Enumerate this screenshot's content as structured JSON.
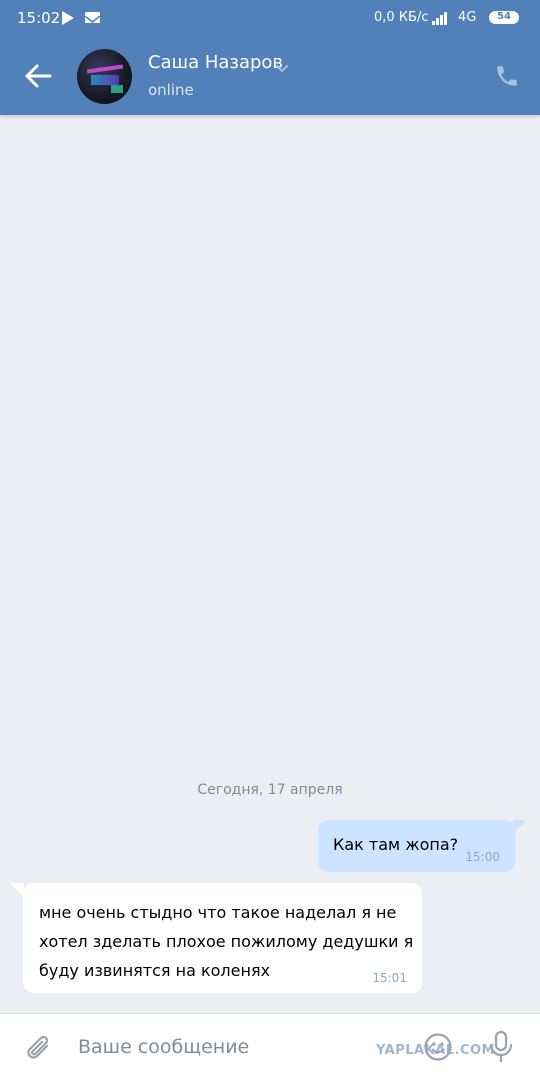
{
  "status_bar": {
    "time": "15:02",
    "speed": "0,0 КБ/с",
    "network": "4G",
    "battery": "54"
  },
  "header": {
    "contact_name": "Саша Назаров",
    "contact_status": "online",
    "accent_color": "#5181b8"
  },
  "chat": {
    "date_separator": "Сегодня, 17 апреля",
    "messages": [
      {
        "direction": "outgoing",
        "text": "Как там жопа?",
        "time": "15:00"
      },
      {
        "direction": "incoming",
        "text": "мне очень стыдно что такое наделал я не хотел зделать плохое пожилому дедушки я буду извинятся на коленях",
        "time": "15:01"
      }
    ]
  },
  "composer": {
    "placeholder": "Ваше сообщение"
  },
  "watermark": "YAPLAKAL.COM",
  "icons": [
    "play-icon",
    "mail-icon",
    "signal-icon",
    "battery-icon",
    "back-arrow-icon",
    "chevron-down-icon",
    "phone-icon",
    "paperclip-icon",
    "emoji-icon",
    "microphone-icon"
  ]
}
